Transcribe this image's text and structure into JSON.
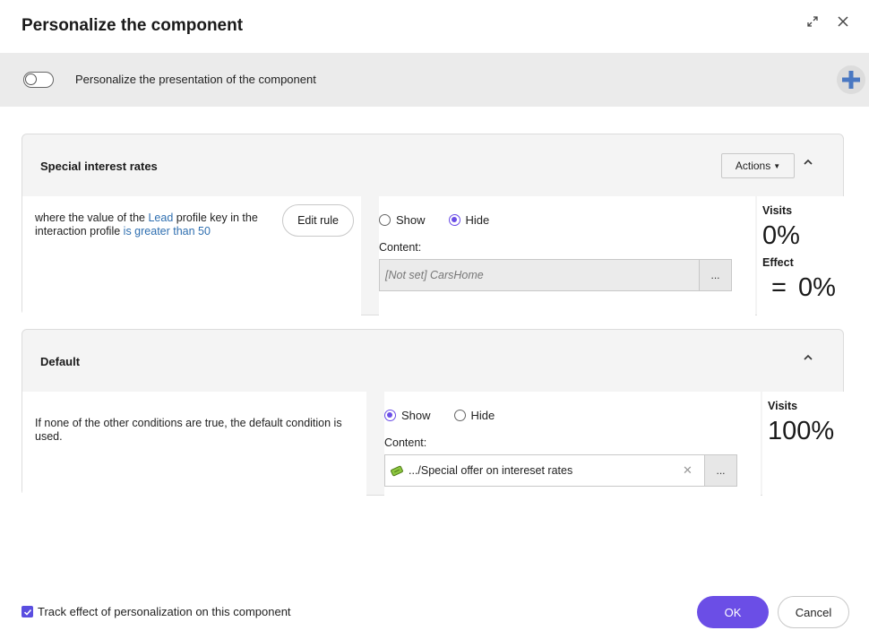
{
  "dialog": {
    "title": "Personalize the component",
    "expand_icon": "expand-icon",
    "close_icon": "close-icon"
  },
  "banner": {
    "toggle_on": false,
    "label": "Personalize the presentation of the component",
    "add_icon": "plus-icon"
  },
  "rules": [
    {
      "title": "Special interest rates",
      "actions_label": "Actions",
      "condition": {
        "prefix": "where the value of the ",
        "key": "Lead",
        "middle": " profile key in the interaction profile ",
        "operator": "is greater than 50"
      },
      "edit_label": "Edit rule",
      "show_label": "Show",
      "hide_label": "Hide",
      "selected": "Hide",
      "content_label": "Content:",
      "content_value": "[Not set] CarsHome",
      "browse_label": "...",
      "visits_label": "Visits",
      "visits_value": "0%",
      "effect_label": "Effect",
      "effect_sign": "=",
      "effect_value": "0%"
    },
    {
      "title": "Default",
      "condition_text": "If none of the other conditions are true, the default condition is used.",
      "show_label": "Show",
      "hide_label": "Hide",
      "selected": "Show",
      "content_label": "Content:",
      "content_value": ".../Special offer on intereset rates",
      "content_icon": "content-item-icon",
      "browse_label": "...",
      "visits_label": "Visits",
      "visits_value": "100%"
    }
  ],
  "footer": {
    "track_checked": true,
    "track_label": "Track effect of personalization on this component",
    "ok_label": "OK",
    "cancel_label": "Cancel"
  },
  "colors": {
    "primary": "#6b4ee6",
    "link": "#2f6fb0",
    "plus": "#4a78c2"
  }
}
